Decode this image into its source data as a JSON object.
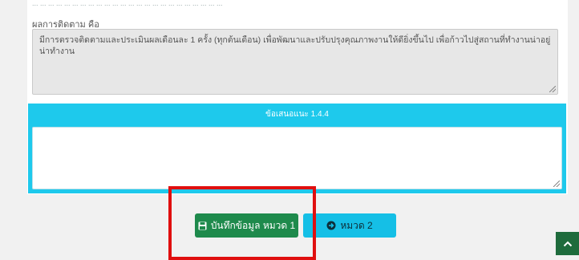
{
  "top_strip": {
    "text": "... ... ... ... ... ... ... ... ... ... ... ... ... ... ... ... ... ... ... ... ... ... ... ..."
  },
  "followup": {
    "label": "ผลการติดตาม คือ",
    "value": "มีการตรวจติดตามและประเมินผลเดือนละ 1 ครั้ง (ทุกต้นเดือน) เพื่อพัฒนาและปรับปรุงคุณภาพงานให้ดียิ่งขึ้นไป เพื่อก้าวไปสู่สถานที่ทำงานน่าอยู่ น่าทำงาน"
  },
  "suggestion": {
    "header": "ข้อเสนอแนะ 1.4.4",
    "value": ""
  },
  "buttons": {
    "save_label": "บันทึกข้อมูล หมวด 1",
    "next_label": "หมวด 2"
  },
  "icons": {
    "save": "floppy-disk-icon",
    "next": "arrow-circle-right-icon",
    "scroll_top": "chevron-up-icon"
  },
  "colors": {
    "panel_accent": "#1ec9ec",
    "save_button": "#1e8a4c",
    "next_button": "#15bfe6",
    "highlight": "#e00f0f",
    "scroll_top": "#1e6b3c"
  }
}
